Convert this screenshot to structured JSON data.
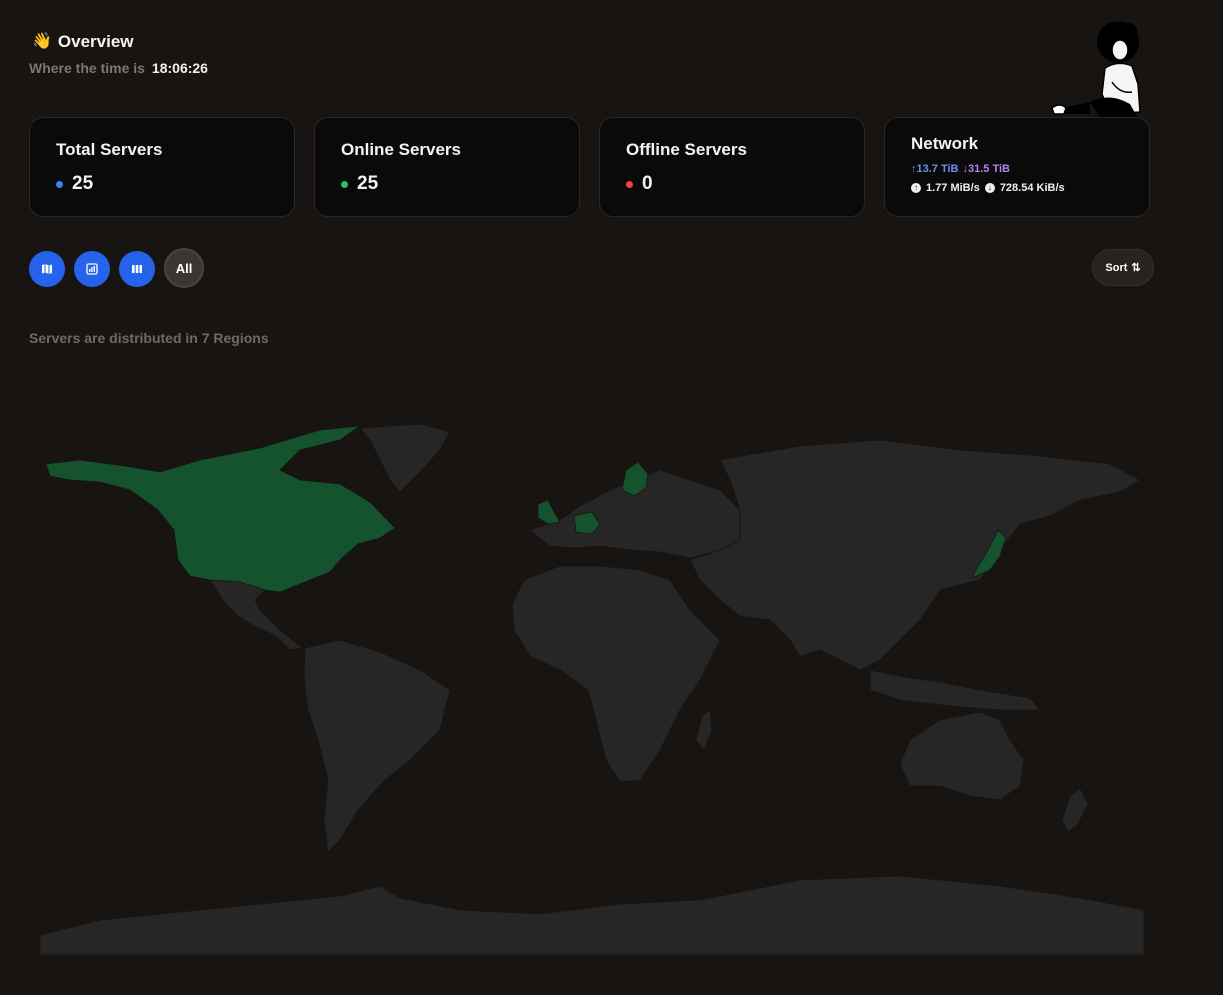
{
  "header": {
    "wave_icon": "👋",
    "title": "Overview",
    "time_label": "Where the time is",
    "time_value": "18:06:26"
  },
  "cards": {
    "total": {
      "title": "Total Servers",
      "value": "25",
      "dot_color": "#3b82f6"
    },
    "online": {
      "title": "Online Servers",
      "value": "25",
      "dot_color": "#22c55e"
    },
    "offline": {
      "title": "Offline Servers",
      "value": "0",
      "dot_color": "#ef4444"
    },
    "network": {
      "title": "Network",
      "up_total": "↑13.7 TiB",
      "down_total": "↓31.5 TiB",
      "up_speed": "1.77 MiB/s",
      "down_speed": "728.54 KiB/s"
    }
  },
  "toolbar": {
    "buttons": [
      {
        "name": "map-view-button",
        "icon": "map-icon"
      },
      {
        "name": "chart-view-button",
        "icon": "bar-chart-icon"
      },
      {
        "name": "grid-view-button",
        "icon": "columns-icon"
      }
    ],
    "all_label": "All",
    "sort_label": "Sort",
    "accent": "#2563eb"
  },
  "regions": {
    "text": "Servers are distributed in 7 Regions",
    "highlight_color": "#14532d",
    "land_color": "#262626"
  }
}
